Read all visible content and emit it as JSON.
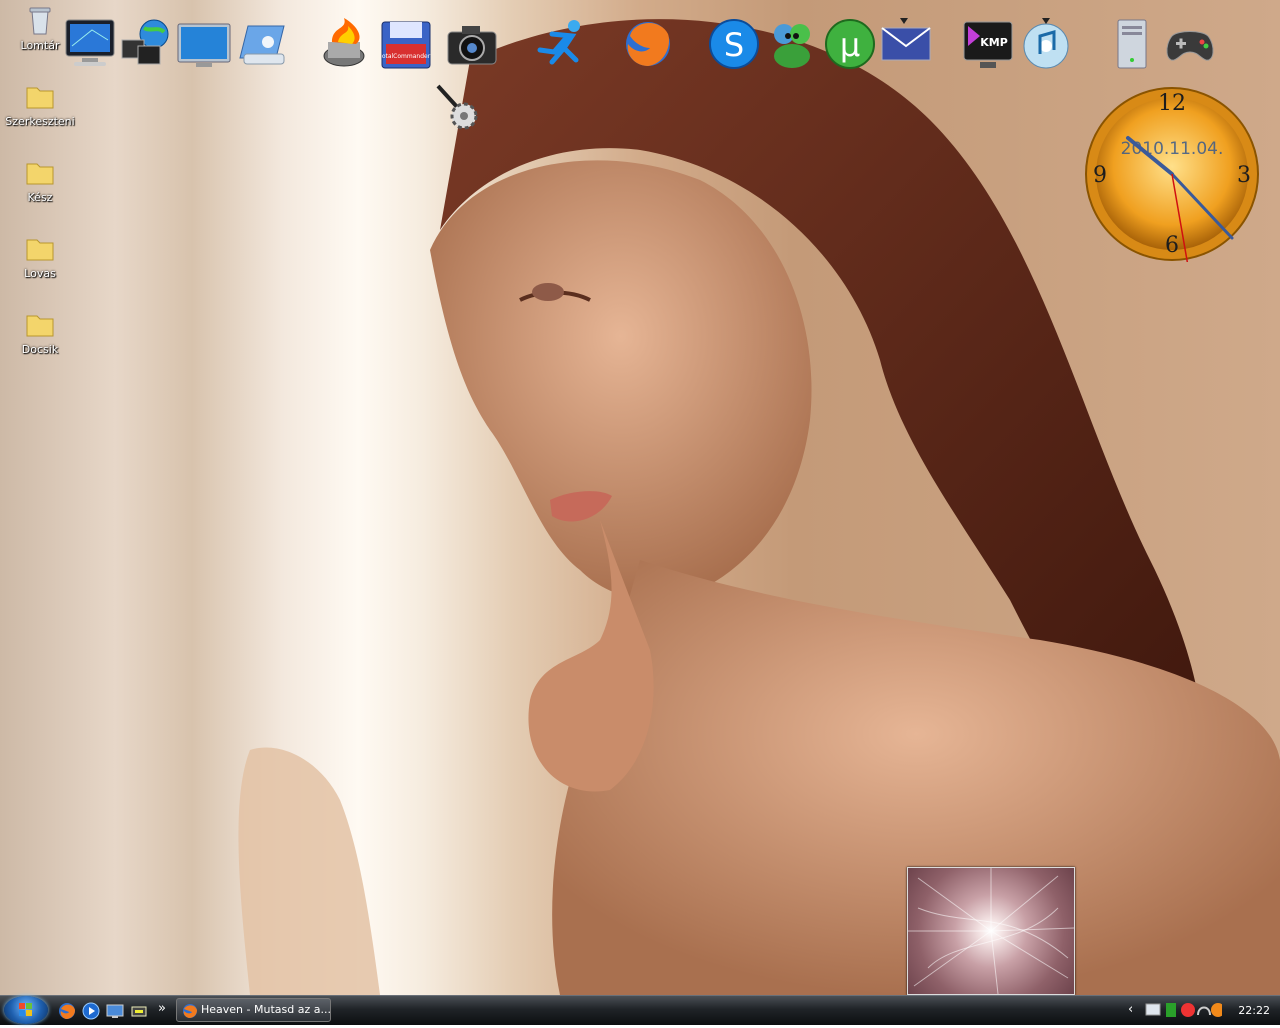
{
  "desktop": {
    "icons": [
      {
        "label": "Lomtár",
        "icon": "recycle-bin-icon"
      },
      {
        "label": "Szerkeszteni",
        "icon": "folder-icon"
      },
      {
        "label": "Kész",
        "icon": "folder-icon"
      },
      {
        "label": "Lovas",
        "icon": "folder-icon"
      },
      {
        "label": "Docsik",
        "icon": "folder-icon"
      }
    ]
  },
  "dock": {
    "apps": [
      "my-computer-icon",
      "network-icon",
      "monitor-icon",
      "control-panel-icon",
      "nero-burning-icon",
      "total-commander-icon",
      "camera-icon",
      "runner-icon",
      "firefox-icon",
      "skype-icon",
      "messenger-icon",
      "utorrent-icon",
      "mail-icon",
      "kmplayer-icon",
      "itunes-icon",
      "server-icon",
      "gamepad-icon",
      "settings-gear-icon"
    ],
    "kmp_label": "KMP",
    "tc_label": "otalCommander"
  },
  "clock_widget": {
    "date": "2010.11.04.",
    "numerals": {
      "n12": "12",
      "n3": "3",
      "n6": "6",
      "n9": "9"
    }
  },
  "taskbar": {
    "task_title": "Heaven - Mutasd az a...",
    "overflow_label": "»",
    "tray_expand": "‹",
    "time": "22:22"
  },
  "colors": {
    "taskbar_top": "#4a4f55",
    "taskbar_bottom": "#0c0e10",
    "clock_face": "#f0a020",
    "accent": "#1e5fae"
  }
}
